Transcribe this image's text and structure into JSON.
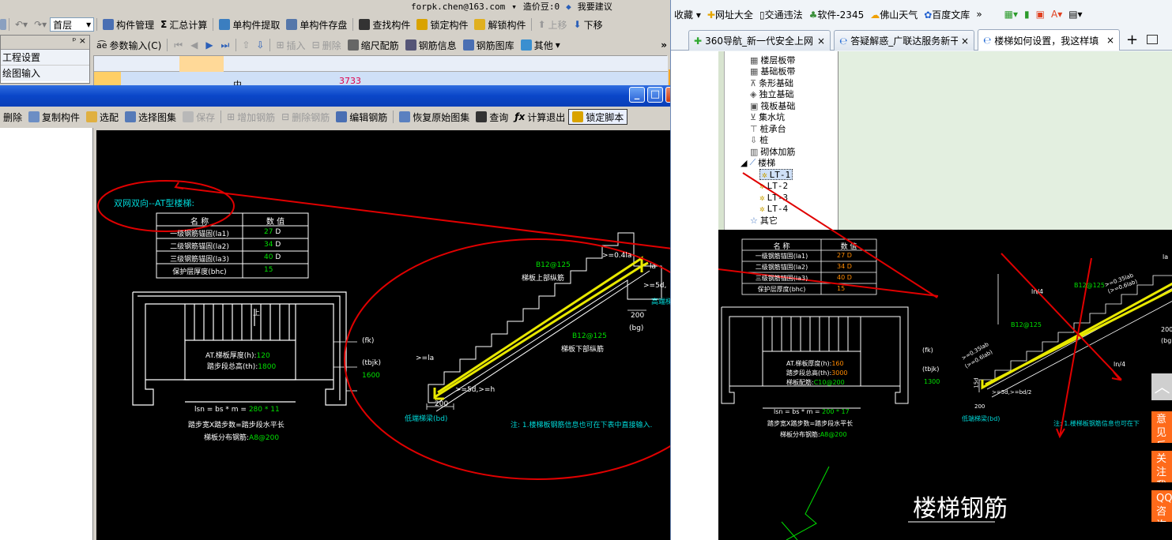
{
  "app_top": {
    "floor_select": "首层",
    "email": "forpk.chen@163.com",
    "price_label": "造价豆:0",
    "suggest": "我要建议",
    "toolbar1": [
      "构件管理",
      "汇总计算",
      "单构件提取",
      "单构件存盘",
      "查找构件",
      "锁定构件",
      "解锁构件",
      "上移",
      "下移"
    ],
    "toolbar2": [
      "参数输入(C)",
      "插入",
      "删除",
      "缩尺配筋",
      "钢筋信息",
      "钢筋图库",
      "其他"
    ],
    "left_panel": [
      "工程设置",
      "绘图输入"
    ],
    "grid_value": "3733",
    "grid_mid": "中"
  },
  "dialog": {
    "toolbar": [
      "删除",
      "复制构件",
      "选配",
      "选择图集",
      "保存",
      "增加钢筋",
      "删除钢筋",
      "编辑钢筋",
      "恢复原始图集",
      "查询",
      "计算退出",
      "锁定脚本"
    ],
    "window_buttons": [
      "_",
      "□",
      "×"
    ]
  },
  "cad": {
    "title": "双网双向--AT型楼梯:",
    "table_headers": [
      "名  称",
      "数  值"
    ],
    "table_rows": [
      {
        "name": "一级钢筋锚固(la1)",
        "value": "27",
        "unit": "D"
      },
      {
        "name": "二级钢筋锚固(la2)",
        "value": "34",
        "unit": "D"
      },
      {
        "name": "三级钢筋锚固(la3)",
        "value": "40",
        "unit": "D"
      },
      {
        "name": "保护层厚度(bhc)",
        "value": "15",
        "unit": ""
      }
    ],
    "plan_text1": "AT.梯板厚度(h):",
    "plan_value1": "120",
    "plan_text2": "踏步段总高(th):",
    "plan_value2": "1800",
    "up_label": "上",
    "fk": "(fk)",
    "tbjk": "(tbjk)",
    "tbjk_value": "1600",
    "lsn_text": "lsn = bs * m = ",
    "lsn_value": "280 * 11",
    "step_text": "踏步宽X踏步数=踏步段水平长",
    "dist_text": "梯板分布钢筋:",
    "dist_value": "A8@200",
    "top_bar": "B12@125",
    "top_bar_label": "梯板上部纵筋",
    "bot_bar": "B12@125",
    "bot_bar_label": "梯板下部纵筋",
    "anchor_top": ">=0.4la",
    "anchor_right": ">=5d,",
    "la_right": "la",
    "la_left": ">=la",
    "anchor_bot": ">=5d,>=h",
    "dim_200a": "200",
    "dim_200b": "200",
    "bg": "(bg)",
    "high_beam": "高端梯梁",
    "low_beam": "低端梯梁(bd)",
    "note": "注: 1.楼梯板钢筋信息也可在下表中直接输入."
  },
  "browser": {
    "bookmarks": [
      "收藏",
      "网址大全",
      "交通违法",
      "软件-2345",
      "佛山天气",
      "百度文库"
    ],
    "tabs": [
      "360导航_新一代安全上网",
      "答疑解惑_广联达服务新干",
      "楼梯如何设置，我这样填"
    ],
    "tree": [
      {
        "label": "楼层板带"
      },
      {
        "label": "基础板带"
      },
      {
        "label": "条形基础"
      },
      {
        "label": "独立基础"
      },
      {
        "label": "筏板基础"
      },
      {
        "label": "集水坑"
      },
      {
        "label": "桩承台"
      },
      {
        "label": "桩"
      },
      {
        "label": "砌体加筋"
      },
      {
        "label": "楼梯"
      },
      {
        "label": "LT-1"
      },
      {
        "label": "LT-2"
      },
      {
        "label": "LT-3"
      },
      {
        "label": "LT-4"
      },
      {
        "label": "其它"
      }
    ],
    "cad2": {
      "table_headers": [
        "名  称",
        "数  值"
      ],
      "rows": [
        {
          "name": "一级钢筋锚固(la1)",
          "value": "27 D"
        },
        {
          "name": "二级钢筋锚固(la2)",
          "value": "34 D"
        },
        {
          "name": "三级钢筋锚固(la3)",
          "value": "40 D"
        },
        {
          "name": "保护层厚度(bhc)",
          "value": "15"
        }
      ],
      "plan1": "AT.梯板厚度(h):",
      "plan1v": "160",
      "plan2": "踏步段总高(th):",
      "plan2v": "3000",
      "plan3": "梯板配筋:",
      "plan3v": "C10@200",
      "fk": "(fk)",
      "tbjk": "(tbjk)",
      "tbjkv": "1300",
      "lsn": "lsn = bs * m = ",
      "lsnv": "200 * 17",
      "step": "踏步宽X踏步数=踏步段水平长",
      "dist": "梯板分布钢筋:",
      "distv": "A8@200",
      "bar1": "B12@125",
      "bar2": "B12@125",
      "ln4a": "ln/4",
      "ln4b": "ln/4",
      "dim200": "200",
      "bg": "(bg)",
      "la": "la",
      "low_beam": "低端梯梁(bd)",
      "note": "注: 1.楼梯板钢筋信息也可在下",
      "dim_a": ">=0.35lab",
      "dim_b": "(>=0.6lab)",
      "dim_c": ">=5d,>=bd/2",
      "dim_d": "15d",
      "dim_e": ">=0.35lab",
      "dim_f": "(>=0.6lab)",
      "big_title": "楼梯钢筋"
    },
    "side_buttons": [
      "意见反馈",
      "关注我们",
      "QQ咨询"
    ]
  }
}
